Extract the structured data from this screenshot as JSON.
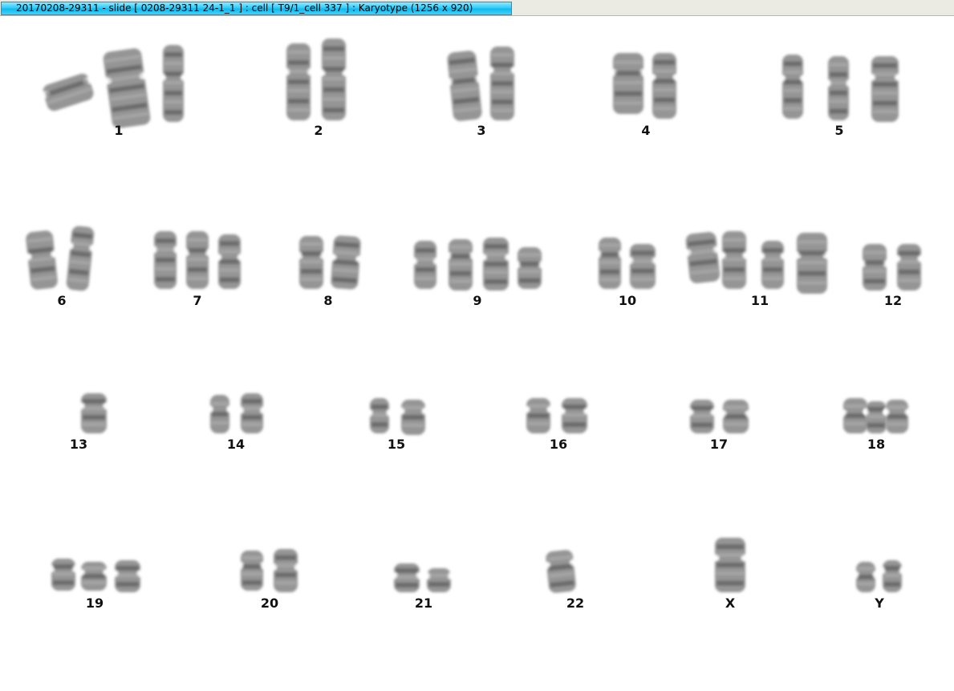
{
  "window": {
    "title": "20170208-29311 - slide [ 0208-29311 24-1_1 ] : cell [ T9/1_cell 337 ] : Karyotype  (1256 x 920)"
  },
  "karyotype": {
    "groups": [
      {
        "label": "1",
        "copies": 3
      },
      {
        "label": "2",
        "copies": 2
      },
      {
        "label": "3",
        "copies": 2
      },
      {
        "label": "4",
        "copies": 2
      },
      {
        "label": "5",
        "copies": 3
      },
      {
        "label": "6",
        "copies": 2
      },
      {
        "label": "7",
        "copies": 3
      },
      {
        "label": "8",
        "copies": 2
      },
      {
        "label": "9",
        "copies": 4
      },
      {
        "label": "10",
        "copies": 2
      },
      {
        "label": "11",
        "copies": 4
      },
      {
        "label": "12",
        "copies": 2
      },
      {
        "label": "13",
        "copies": 1
      },
      {
        "label": "14",
        "copies": 2
      },
      {
        "label": "15",
        "copies": 2
      },
      {
        "label": "16",
        "copies": 2
      },
      {
        "label": "17",
        "copies": 2
      },
      {
        "label": "18",
        "copies": 3
      },
      {
        "label": "19",
        "copies": 3
      },
      {
        "label": "20",
        "copies": 2
      },
      {
        "label": "21",
        "copies": 2
      },
      {
        "label": "22",
        "copies": 1
      },
      {
        "label": "X",
        "copies": 1
      },
      {
        "label": "Y",
        "copies": 2
      }
    ],
    "colors": {
      "chromatid": "#8a8a8a",
      "band_dark": "#4a4a4a",
      "band_light": "#b8b8b8",
      "title_bar": "#2fcdfb"
    }
  }
}
